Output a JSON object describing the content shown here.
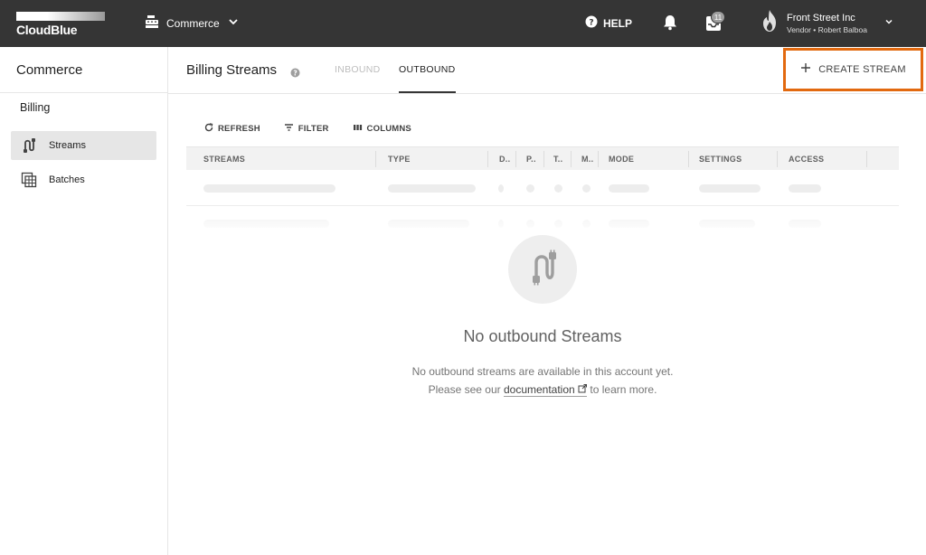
{
  "topbar": {
    "logo_text": "CloudBlue",
    "module_label": "Commerce",
    "help_label": "HELP",
    "notifications_count": "11",
    "account_name": "Front Street Inc",
    "account_sub": "Vendor • Robert Balboa",
    "background": "#353535"
  },
  "sidebar": {
    "title": "Commerce",
    "section": "Billing",
    "items": [
      {
        "label": "Streams",
        "icon": "streams-icon",
        "active": true
      },
      {
        "label": "Batches",
        "icon": "batches-icon",
        "active": false
      }
    ]
  },
  "header": {
    "title": "Billing Streams",
    "tabs": [
      {
        "label": "INBOUND",
        "active": false
      },
      {
        "label": "OUTBOUND",
        "active": true
      }
    ],
    "create_button_label": "CREATE STREAM",
    "highlight_color": "#e2690f"
  },
  "toolbar": {
    "refresh_label": "REFRESH",
    "filter_label": "FILTER",
    "columns_label": "COLUMNS"
  },
  "table": {
    "columns": [
      "STREAMS",
      "TYPE",
      "D..",
      "P..",
      "T..",
      "M..",
      "MODE",
      "SETTINGS",
      "ACCESS"
    ]
  },
  "empty_state": {
    "icon": "streams-icon",
    "title": "No outbound Streams",
    "line1": "No outbound streams are available in this account yet.",
    "line2_prefix": "Please see our",
    "link_text": "documentation",
    "line2_suffix": "to learn more."
  }
}
